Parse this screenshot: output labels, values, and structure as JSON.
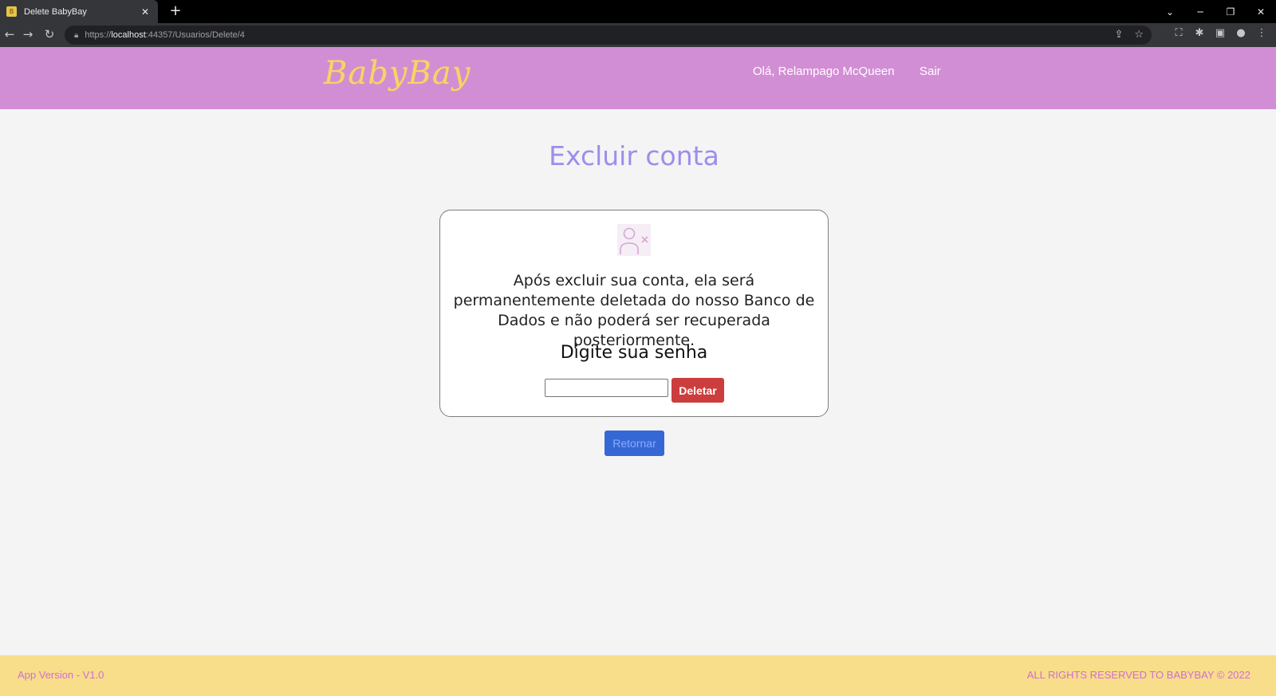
{
  "browser": {
    "tab_title": "Delete BabyBay",
    "favicon_letter": "B",
    "url_scheme": "https://",
    "url_host": "localhost",
    "url_rest": ":44357/Usuarios/Delete/4"
  },
  "header": {
    "logo": "BabyBay",
    "greeting": "Olá, Relampago McQueen",
    "logout": "Sair"
  },
  "main": {
    "title": "Excluir conta",
    "warning": "Após excluir sua conta, ela será permanentemente deletada do nosso Banco de Dados e não poderá ser recuperada posteriormente.",
    "password_prompt": "Digite sua senha",
    "password_value": "",
    "delete_button": "Deletar",
    "return_button": "Retornar"
  },
  "footer": {
    "version": "App Version - V1.0",
    "rights": "ALL RIGHTS RESERVED TO BABYBAY © 2022"
  },
  "colors": {
    "header_bg": "#d28ed4",
    "logo": "#f7d36b",
    "title": "#a08cec",
    "delete": "#cc3d3d",
    "return": "#3568d4",
    "footer_bg": "#f8dd8a",
    "footer_text": "#cf70cf"
  }
}
